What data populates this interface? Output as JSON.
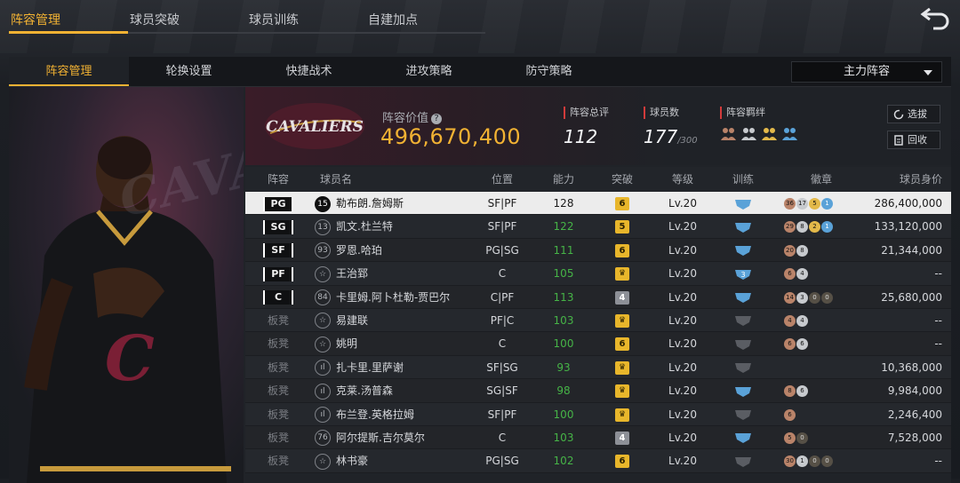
{
  "top_tabs": [
    "阵容管理",
    "球员突破",
    "球员训练",
    "自建加点"
  ],
  "sub_tabs": [
    "阵容管理",
    "轮换设置",
    "快捷战术",
    "进攻策略",
    "防守策略"
  ],
  "lineup_select": "主力阵容",
  "team": {
    "value_label": "阵容价值",
    "value": "496,670,400",
    "total_label": "阵容总评",
    "total": "112",
    "count_label": "球员数",
    "count": "177",
    "count_max": "/300",
    "bond_label": "阵容羁绊",
    "logo_text": "CAVALIERS"
  },
  "buttons": {
    "scout": "选拔",
    "recycle": "回收"
  },
  "columns": [
    "阵容",
    "球员名",
    "位置",
    "能力",
    "突破",
    "等级",
    "训练",
    "徽章",
    "球员身价"
  ],
  "colors": {
    "accent": "#f2b233",
    "green": "#46b447"
  },
  "rows": [
    {
      "slot": "PG",
      "num": "15",
      "name": "勒布朗.詹姆斯",
      "pos": "SF|PF",
      "rating": "128",
      "brk": "6",
      "lv": "Lv.20",
      "train": "blue",
      "badges": [
        [
          "36",
          "br"
        ],
        [
          "17",
          "si"
        ],
        [
          "5",
          "go"
        ],
        [
          "1",
          "bl"
        ]
      ],
      "price": "286,400,000",
      "starter": true,
      "sel": true
    },
    {
      "slot": "SG",
      "num": "13",
      "name": "凯文.杜兰特",
      "pos": "SF|PF",
      "rating": "122",
      "brk": "5",
      "lv": "Lv.20",
      "train": "blue",
      "badges": [
        [
          "29",
          "br"
        ],
        [
          "8",
          "si"
        ],
        [
          "2",
          "go"
        ],
        [
          "1",
          "bl"
        ]
      ],
      "price": "133,120,000",
      "starter": true
    },
    {
      "slot": "SF",
      "num": "93",
      "name": "罗恩.哈珀",
      "pos": "PG|SG",
      "rating": "111",
      "brk": "6",
      "lv": "Lv.20",
      "train": "blue",
      "badges": [
        [
          "20",
          "br"
        ],
        [
          "8",
          "si"
        ]
      ],
      "price": "21,344,000",
      "starter": true
    },
    {
      "slot": "PF",
      "num": "☆",
      "name": "王治郅",
      "pos": "C",
      "rating": "105",
      "brk": "♛",
      "lv": "Lv.20",
      "train": "blue3",
      "badges": [
        [
          "6",
          "br"
        ],
        [
          "4",
          "si"
        ]
      ],
      "price": "--",
      "starter": true
    },
    {
      "slot": "C",
      "num": "84",
      "name": "卡里姆.阿卜杜勒-贾巴尔",
      "pos": "C|PF",
      "rating": "113",
      "brk": "4",
      "lv": "Lv.20",
      "train": "blue",
      "badges": [
        [
          "14",
          "br"
        ],
        [
          "3",
          "si"
        ],
        [
          "0",
          "dk"
        ],
        [
          "0",
          "dk"
        ]
      ],
      "price": "25,680,000",
      "starter": true
    },
    {
      "slot": "板凳",
      "num": "☆",
      "name": "易建联",
      "pos": "PF|C",
      "rating": "103",
      "brk": "♛",
      "lv": "Lv.20",
      "train": "gray",
      "badges": [
        [
          "4",
          "br"
        ],
        [
          "4",
          "si"
        ]
      ],
      "price": "--"
    },
    {
      "slot": "板凳",
      "num": "☆",
      "name": "姚明",
      "pos": "C",
      "rating": "100",
      "brk": "6",
      "lv": "Lv.20",
      "train": "gray",
      "badges": [
        [
          "6",
          "br"
        ],
        [
          "6",
          "si"
        ]
      ],
      "price": "--"
    },
    {
      "slot": "板凳",
      "num": "ıl",
      "name": "扎卡里.里萨谢",
      "pos": "SF|SG",
      "rating": "93",
      "brk": "♛",
      "lv": "Lv.20",
      "train": "gray",
      "badges": [],
      "price": "10,368,000"
    },
    {
      "slot": "板凳",
      "num": "ıl",
      "name": "克莱.汤普森",
      "pos": "SG|SF",
      "rating": "98",
      "brk": "♛",
      "lv": "Lv.20",
      "train": "blue",
      "badges": [
        [
          "8",
          "br"
        ],
        [
          "6",
          "si"
        ]
      ],
      "price": "9,984,000"
    },
    {
      "slot": "板凳",
      "num": "ıl",
      "name": "布兰登.英格拉姆",
      "pos": "SF|PF",
      "rating": "100",
      "brk": "♛",
      "lv": "Lv.20",
      "train": "gray",
      "badges": [
        [
          "6",
          "br"
        ]
      ],
      "price": "2,246,400"
    },
    {
      "slot": "板凳",
      "num": "76",
      "name": "阿尔提斯.吉尔莫尔",
      "pos": "C",
      "rating": "103",
      "brk": "4",
      "lv": "Lv.20",
      "train": "blue",
      "badges": [
        [
          "5",
          "br"
        ],
        [
          "0",
          "dk"
        ]
      ],
      "price": "7,528,000"
    },
    {
      "slot": "板凳",
      "num": "☆",
      "name": "林书豪",
      "pos": "PG|SG",
      "rating": "102",
      "brk": "6",
      "lv": "Lv.20",
      "train": "gray",
      "badges": [
        [
          "30",
          "br"
        ],
        [
          "1",
          "si"
        ],
        [
          "0",
          "dk"
        ],
        [
          "0",
          "dk"
        ]
      ],
      "price": "--"
    }
  ]
}
